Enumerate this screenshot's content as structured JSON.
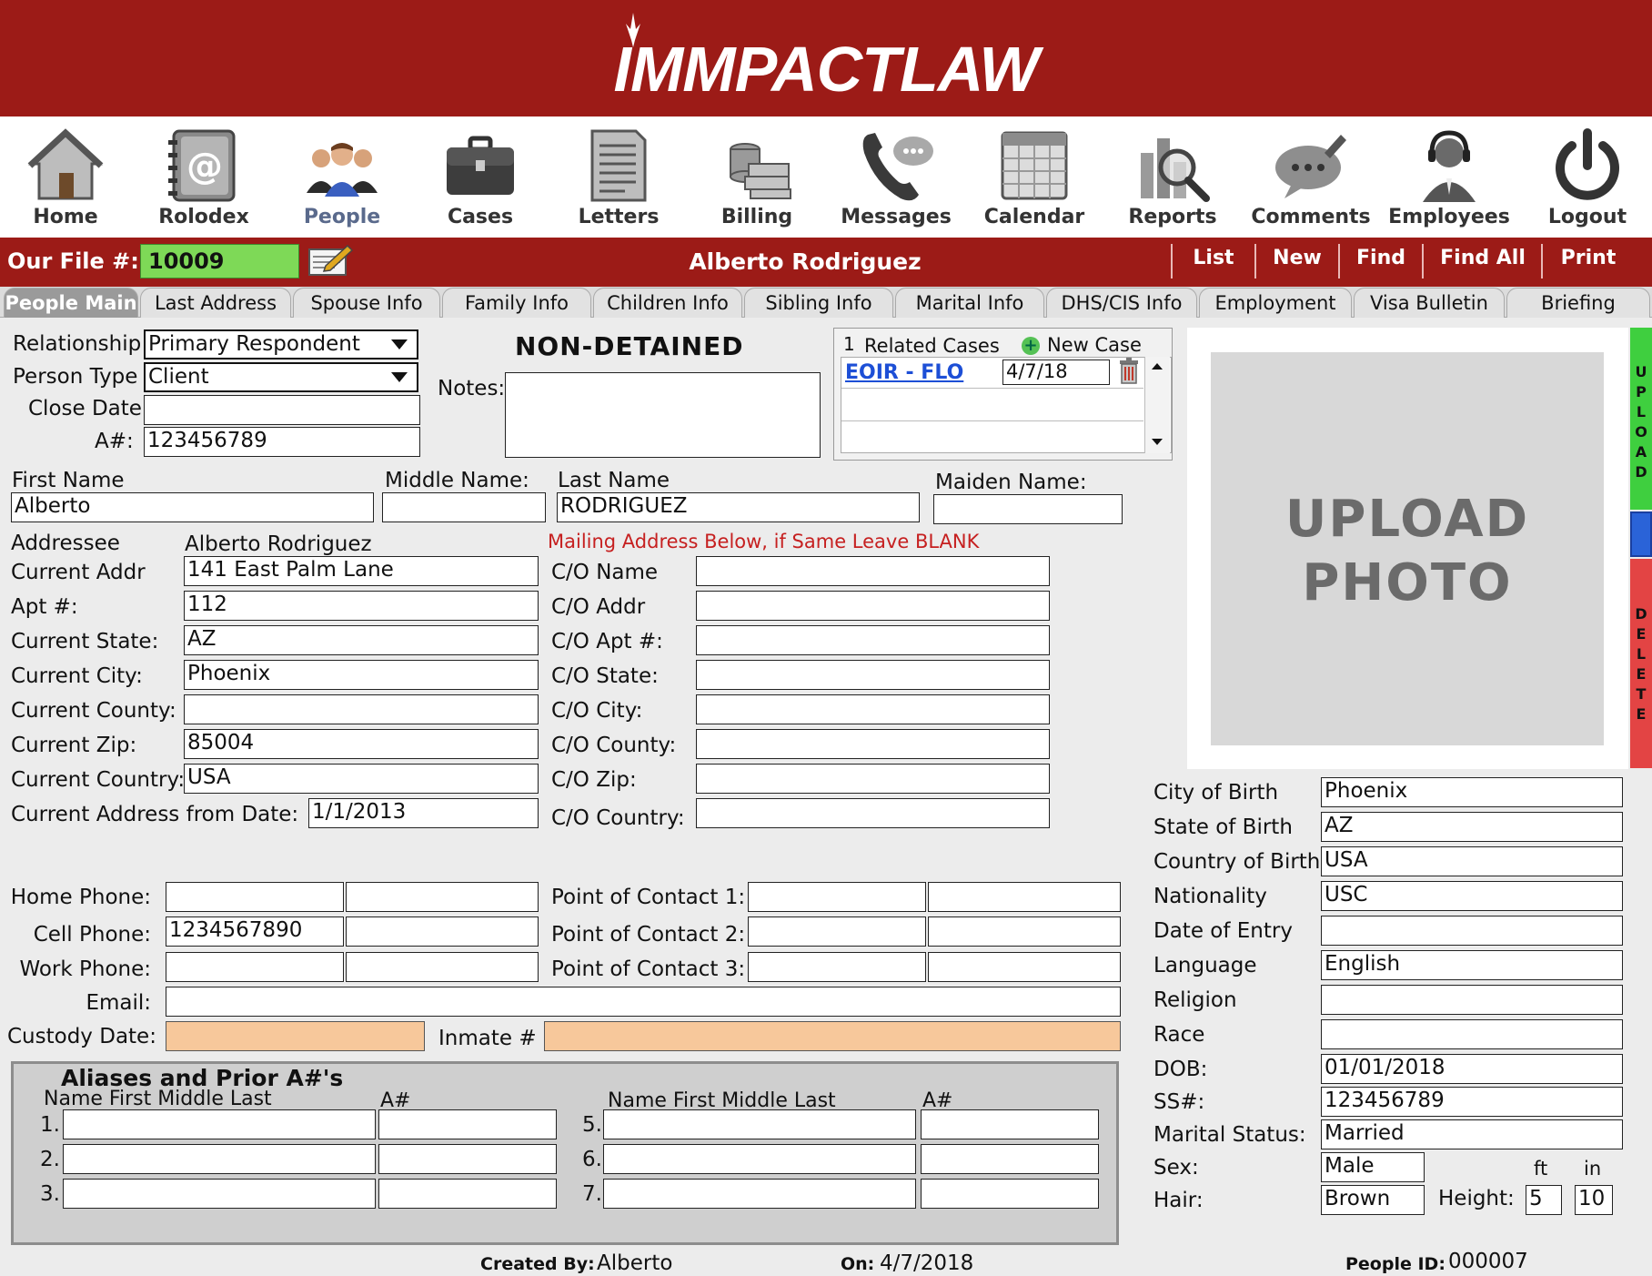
{
  "app": {
    "logo_text": "IMMPACTLAW"
  },
  "nav": {
    "items": [
      {
        "label": "Home",
        "icon": "house-icon"
      },
      {
        "label": "Rolodex",
        "icon": "rolodex-icon"
      },
      {
        "label": "People",
        "icon": "people-icon",
        "active": true
      },
      {
        "label": "Cases",
        "icon": "briefcase-icon"
      },
      {
        "label": "Letters",
        "icon": "letters-icon"
      },
      {
        "label": "Billing",
        "icon": "money-icon"
      },
      {
        "label": "Messages",
        "icon": "phone-icon"
      },
      {
        "label": "Calendar",
        "icon": "calendar-icon"
      },
      {
        "label": "Reports",
        "icon": "reports-icon"
      },
      {
        "label": "Comments",
        "icon": "comments-icon"
      },
      {
        "label": "Employees",
        "icon": "employee-icon"
      },
      {
        "label": "Logout",
        "icon": "power-icon"
      }
    ]
  },
  "filebar": {
    "label": "Our File #:",
    "file_number": "10009",
    "person_name": "Alberto Rodriguez",
    "actions": [
      "List",
      "New",
      "Find",
      "Find All",
      "Print"
    ]
  },
  "tabs": [
    "People Main",
    "Last Address",
    "Spouse Info",
    "Family Info",
    "Children Info",
    "Sibling Info",
    "Marital Info",
    "DHS/CIS Info",
    "Employment",
    "Visa Bulletin",
    "Briefing"
  ],
  "active_tab": "People Main",
  "status": {
    "relationship_label": "Relationship",
    "relationship": "Primary Respondent",
    "person_type_label": "Person Type",
    "person_type": "Client",
    "close_date_label": "Close Date",
    "close_date": "",
    "a_number_label": "A#:",
    "a_number": "123456789",
    "detention": "NON-DETAINED",
    "notes_label": "Notes:",
    "notes": ""
  },
  "related_cases": {
    "count": "1",
    "title": "Related Cases",
    "new_case_label": "New Case",
    "cases": [
      {
        "name": "EOIR - FLO",
        "date": "4/7/18"
      }
    ]
  },
  "name": {
    "first_label": "First Name",
    "first": "Alberto",
    "middle_label": "Middle Name:",
    "middle": "",
    "last_label": "Last Name",
    "last": "RODRIGUEZ",
    "maiden_label": "Maiden Name:",
    "maiden": ""
  },
  "address": {
    "addressee_label": "Addressee",
    "addressee": "Alberto Rodriguez",
    "mailing_note": "Mailing Address Below, if Same Leave BLANK",
    "fields": [
      {
        "label": "Current Addr",
        "value": "141 East Palm Lane"
      },
      {
        "label": "Apt #:",
        "value": "112"
      },
      {
        "label": "Current State:",
        "value": "AZ"
      },
      {
        "label": "Current City:",
        "value": "Phoenix"
      },
      {
        "label": "Current County:",
        "value": ""
      },
      {
        "label": "Current Zip:",
        "value": "85004"
      },
      {
        "label": "Current Country:",
        "value": "USA"
      }
    ],
    "from_date_label": "Current Address from Date:",
    "from_date": "1/1/2013",
    "co_fields": [
      {
        "label": "C/O Name",
        "value": ""
      },
      {
        "label": "C/O Addr",
        "value": ""
      },
      {
        "label": "C/O Apt #:",
        "value": ""
      },
      {
        "label": "C/O State:",
        "value": ""
      },
      {
        "label": "C/O City:",
        "value": ""
      },
      {
        "label": "C/O County:",
        "value": ""
      },
      {
        "label": "C/O Zip:",
        "value": ""
      },
      {
        "label": "C/O Country:",
        "value": ""
      }
    ]
  },
  "contact": {
    "home_label": "Home Phone:",
    "home": "",
    "home2": "",
    "cell_label": "Cell Phone:",
    "cell": "1234567890",
    "cell2": "",
    "work_label": "Work Phone:",
    "work": "",
    "work2": "",
    "email_label": "Email:",
    "email": "",
    "poc": [
      {
        "label": "Point of Contact 1:",
        "a": "",
        "b": ""
      },
      {
        "label": "Point of Contact 2:",
        "a": "",
        "b": ""
      },
      {
        "label": "Point of Contact 3:",
        "a": "",
        "b": ""
      }
    ],
    "custody_label": "Custody Date:",
    "custody": "",
    "inmate_label": "Inmate #",
    "inmate": ""
  },
  "aliases": {
    "title": "Aliases and Prior  A#'s",
    "name_header": "Name First Middle Last",
    "a_header": "A#",
    "left_rows": [
      {
        "n": "1."
      },
      {
        "n": "2."
      },
      {
        "n": "3."
      }
    ],
    "right_rows": [
      {
        "n": "5."
      },
      {
        "n": "6."
      },
      {
        "n": "7."
      }
    ]
  },
  "photo": {
    "text_line1": "UPLOAD",
    "text_line2": "PHOTO",
    "upload_letters": "UPLOAD",
    "delete_letters": "DELETE"
  },
  "bio": {
    "fields": [
      {
        "label": "City of Birth",
        "value": "Phoenix"
      },
      {
        "label": "State of Birth",
        "value": "AZ"
      },
      {
        "label": "Country of Birth",
        "value": "USA"
      },
      {
        "label": "Nationality",
        "value": "USC"
      },
      {
        "label": "Date of Entry",
        "value": ""
      },
      {
        "label": "Language",
        "value": "English"
      },
      {
        "label": "Religion",
        "value": ""
      },
      {
        "label": "Race",
        "value": ""
      },
      {
        "label": "DOB:",
        "value": "01/01/2018"
      },
      {
        "label": "SS#:",
        "value": "123456789"
      },
      {
        "label": "Marital Status:",
        "value": "Married"
      }
    ],
    "sex_label": "Sex:",
    "sex": "Male",
    "hair_label": "Hair:",
    "hair": "Brown",
    "height_label": "Height:",
    "ft_label": "ft",
    "in_label": "in",
    "height_ft": "5",
    "height_in": "10"
  },
  "footer": {
    "created_by_label": "Created By:",
    "created_by": "Alberto",
    "on_label": "On:",
    "on": "4/7/2018",
    "people_id_label": "People ID:",
    "people_id": "000007"
  },
  "colors": {
    "brand": "#9c1b17",
    "file_badge": "#7ed957",
    "custody_field": "#f7c89b",
    "upload": "#3fcf3f",
    "delete": "#e34444",
    "link": "#1d4fd6",
    "mailing_note": "#c62020"
  }
}
